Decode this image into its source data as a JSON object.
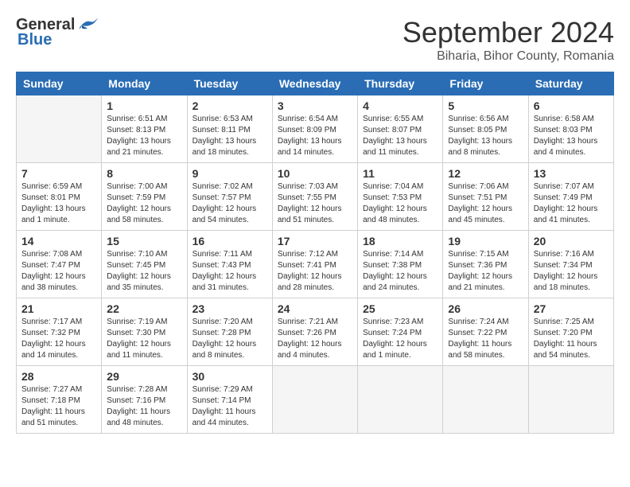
{
  "logo": {
    "general": "General",
    "blue": "Blue"
  },
  "title": "September 2024",
  "subtitle": "Biharia, Bihor County, Romania",
  "weekdays": [
    "Sunday",
    "Monday",
    "Tuesday",
    "Wednesday",
    "Thursday",
    "Friday",
    "Saturday"
  ],
  "days": [
    {
      "num": "",
      "info": ""
    },
    {
      "num": "1",
      "info": "Sunrise: 6:51 AM\nSunset: 8:13 PM\nDaylight: 13 hours\nand 21 minutes."
    },
    {
      "num": "2",
      "info": "Sunrise: 6:53 AM\nSunset: 8:11 PM\nDaylight: 13 hours\nand 18 minutes."
    },
    {
      "num": "3",
      "info": "Sunrise: 6:54 AM\nSunset: 8:09 PM\nDaylight: 13 hours\nand 14 minutes."
    },
    {
      "num": "4",
      "info": "Sunrise: 6:55 AM\nSunset: 8:07 PM\nDaylight: 13 hours\nand 11 minutes."
    },
    {
      "num": "5",
      "info": "Sunrise: 6:56 AM\nSunset: 8:05 PM\nDaylight: 13 hours\nand 8 minutes."
    },
    {
      "num": "6",
      "info": "Sunrise: 6:58 AM\nSunset: 8:03 PM\nDaylight: 13 hours\nand 4 minutes."
    },
    {
      "num": "7",
      "info": "Sunrise: 6:59 AM\nSunset: 8:01 PM\nDaylight: 13 hours\nand 1 minute."
    },
    {
      "num": "8",
      "info": "Sunrise: 7:00 AM\nSunset: 7:59 PM\nDaylight: 12 hours\nand 58 minutes."
    },
    {
      "num": "9",
      "info": "Sunrise: 7:02 AM\nSunset: 7:57 PM\nDaylight: 12 hours\nand 54 minutes."
    },
    {
      "num": "10",
      "info": "Sunrise: 7:03 AM\nSunset: 7:55 PM\nDaylight: 12 hours\nand 51 minutes."
    },
    {
      "num": "11",
      "info": "Sunrise: 7:04 AM\nSunset: 7:53 PM\nDaylight: 12 hours\nand 48 minutes."
    },
    {
      "num": "12",
      "info": "Sunrise: 7:06 AM\nSunset: 7:51 PM\nDaylight: 12 hours\nand 45 minutes."
    },
    {
      "num": "13",
      "info": "Sunrise: 7:07 AM\nSunset: 7:49 PM\nDaylight: 12 hours\nand 41 minutes."
    },
    {
      "num": "14",
      "info": "Sunrise: 7:08 AM\nSunset: 7:47 PM\nDaylight: 12 hours\nand 38 minutes."
    },
    {
      "num": "15",
      "info": "Sunrise: 7:10 AM\nSunset: 7:45 PM\nDaylight: 12 hours\nand 35 minutes."
    },
    {
      "num": "16",
      "info": "Sunrise: 7:11 AM\nSunset: 7:43 PM\nDaylight: 12 hours\nand 31 minutes."
    },
    {
      "num": "17",
      "info": "Sunrise: 7:12 AM\nSunset: 7:41 PM\nDaylight: 12 hours\nand 28 minutes."
    },
    {
      "num": "18",
      "info": "Sunrise: 7:14 AM\nSunset: 7:38 PM\nDaylight: 12 hours\nand 24 minutes."
    },
    {
      "num": "19",
      "info": "Sunrise: 7:15 AM\nSunset: 7:36 PM\nDaylight: 12 hours\nand 21 minutes."
    },
    {
      "num": "20",
      "info": "Sunrise: 7:16 AM\nSunset: 7:34 PM\nDaylight: 12 hours\nand 18 minutes."
    },
    {
      "num": "21",
      "info": "Sunrise: 7:17 AM\nSunset: 7:32 PM\nDaylight: 12 hours\nand 14 minutes."
    },
    {
      "num": "22",
      "info": "Sunrise: 7:19 AM\nSunset: 7:30 PM\nDaylight: 12 hours\nand 11 minutes."
    },
    {
      "num": "23",
      "info": "Sunrise: 7:20 AM\nSunset: 7:28 PM\nDaylight: 12 hours\nand 8 minutes."
    },
    {
      "num": "24",
      "info": "Sunrise: 7:21 AM\nSunset: 7:26 PM\nDaylight: 12 hours\nand 4 minutes."
    },
    {
      "num": "25",
      "info": "Sunrise: 7:23 AM\nSunset: 7:24 PM\nDaylight: 12 hours\nand 1 minute."
    },
    {
      "num": "26",
      "info": "Sunrise: 7:24 AM\nSunset: 7:22 PM\nDaylight: 11 hours\nand 58 minutes."
    },
    {
      "num": "27",
      "info": "Sunrise: 7:25 AM\nSunset: 7:20 PM\nDaylight: 11 hours\nand 54 minutes."
    },
    {
      "num": "28",
      "info": "Sunrise: 7:27 AM\nSunset: 7:18 PM\nDaylight: 11 hours\nand 51 minutes."
    },
    {
      "num": "29",
      "info": "Sunrise: 7:28 AM\nSunset: 7:16 PM\nDaylight: 11 hours\nand 48 minutes."
    },
    {
      "num": "30",
      "info": "Sunrise: 7:29 AM\nSunset: 7:14 PM\nDaylight: 11 hours\nand 44 minutes."
    },
    {
      "num": "",
      "info": ""
    },
    {
      "num": "",
      "info": ""
    },
    {
      "num": "",
      "info": ""
    },
    {
      "num": "",
      "info": ""
    },
    {
      "num": "",
      "info": ""
    }
  ]
}
